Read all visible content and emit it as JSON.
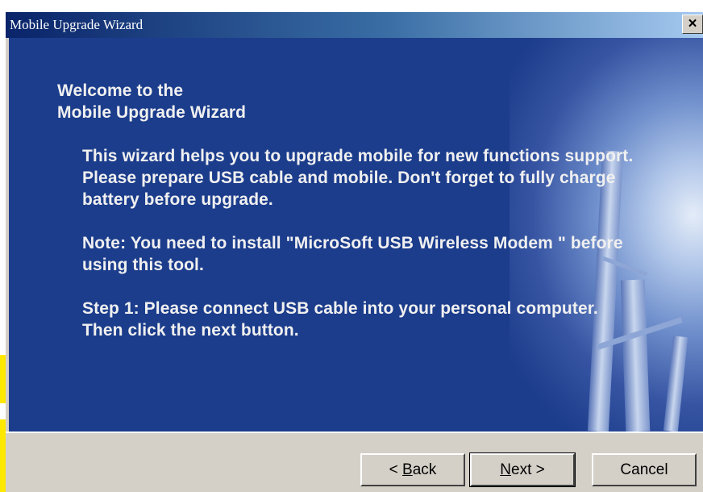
{
  "window": {
    "title": "Mobile Upgrade Wizard",
    "close_label": "×"
  },
  "content": {
    "welcome_line1": "Welcome to the",
    "welcome_line2": "Mobile Upgrade Wizard",
    "paragraph1": "This wizard helps you to upgrade mobile for new functions support. Please prepare USB cable and mobile. Don't forget to fully charge battery before upgrade.",
    "paragraph2": "Note: You need to install \"MicroSoft USB Wireless Modem \" before using this tool.",
    "paragraph3": "Step 1: Please connect USB cable into your personal computer. Then click the next button."
  },
  "buttons": {
    "back_prefix": "< ",
    "back_accel": "B",
    "back_rest": "ack",
    "next_accel": "N",
    "next_rest": "ext >",
    "cancel": "Cancel"
  },
  "colors": {
    "hero_background": "#1c3d8c",
    "title_gradient_start": "#0a246a",
    "title_gradient_end": "#a6caf0",
    "dialog_face": "#d4d0c8",
    "highlight_yellow": "#ffe800"
  }
}
